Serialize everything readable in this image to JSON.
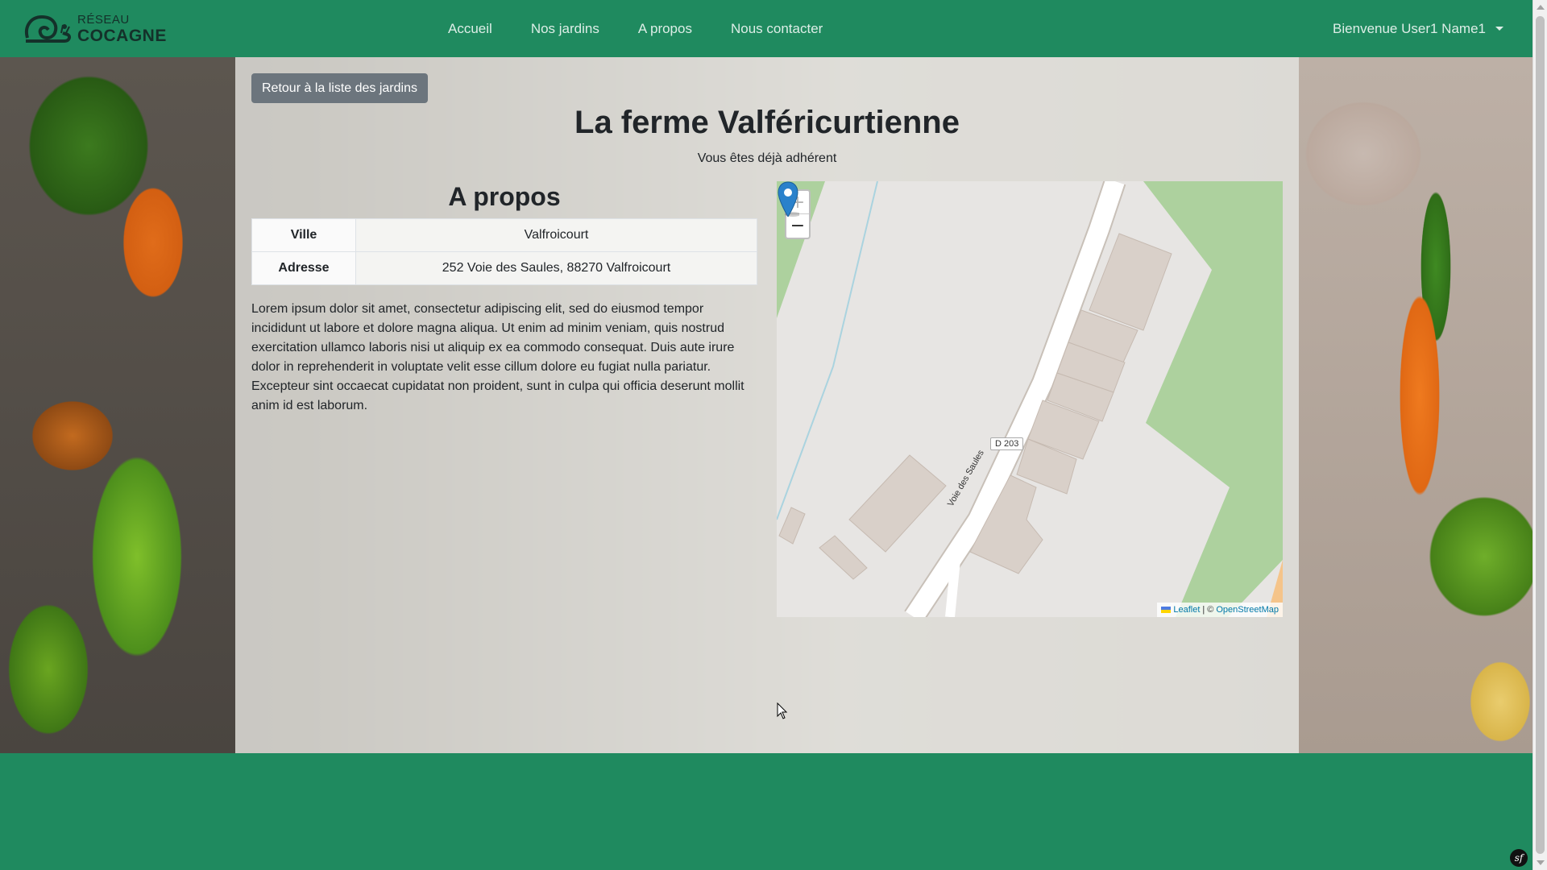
{
  "brand": {
    "small": "RÉSEAU",
    "big": "COCAGNE"
  },
  "nav": {
    "links": [
      "Accueil",
      "Nos jardins",
      "A propos",
      "Nous contacter"
    ],
    "user": "Bienvenue User1 Name1"
  },
  "page": {
    "back_button": "Retour à la liste des jardins",
    "title": "La ferme Valféricurtienne",
    "member_status": "Vous êtes déjà adhérent",
    "about_heading": "A propos",
    "info": [
      {
        "label": "Ville",
        "value": "Valfroicourt"
      },
      {
        "label": "Adresse",
        "value": "252 Voie des Saules, 88270 Valfroicourt"
      }
    ],
    "description": "Lorem ipsum dolor sit amet, consectetur adipiscing elit, sed do eiusmod tempor incididunt ut labore et dolore magna aliqua. Ut enim ad minim veniam, quis nostrud exercitation ullamco laboris nisi ut aliquip ex ea commodo consequat. Duis aute irure dolor in reprehenderit in voluptate velit esse cillum dolore eu fugiat nulla pariatur. Excepteur sint occaecat cupidatat non proident, sunt in culpa qui officia deserunt mollit anim id est laborum."
  },
  "map": {
    "zoom_in": "+",
    "zoom_out": "−",
    "road_label": "D 203",
    "street_name": "Voie des Saules",
    "attribution": {
      "leaflet": "Leaflet",
      "sep": "|",
      "copyright": "©",
      "osm": "OpenStreetMap"
    },
    "colors": {
      "land": "#e7e5e3",
      "wood": "#add19e",
      "building": "#d9d0c9",
      "road": "#ffffff",
      "water": "#aad3df",
      "marker": "#2a81cb"
    }
  },
  "colors": {
    "navbar": "#1f8a5f",
    "button": "#6c757d"
  },
  "icons": {
    "brand": "snail-logo-icon",
    "marker": "map-marker-icon",
    "symfony": "symfony-icon"
  }
}
